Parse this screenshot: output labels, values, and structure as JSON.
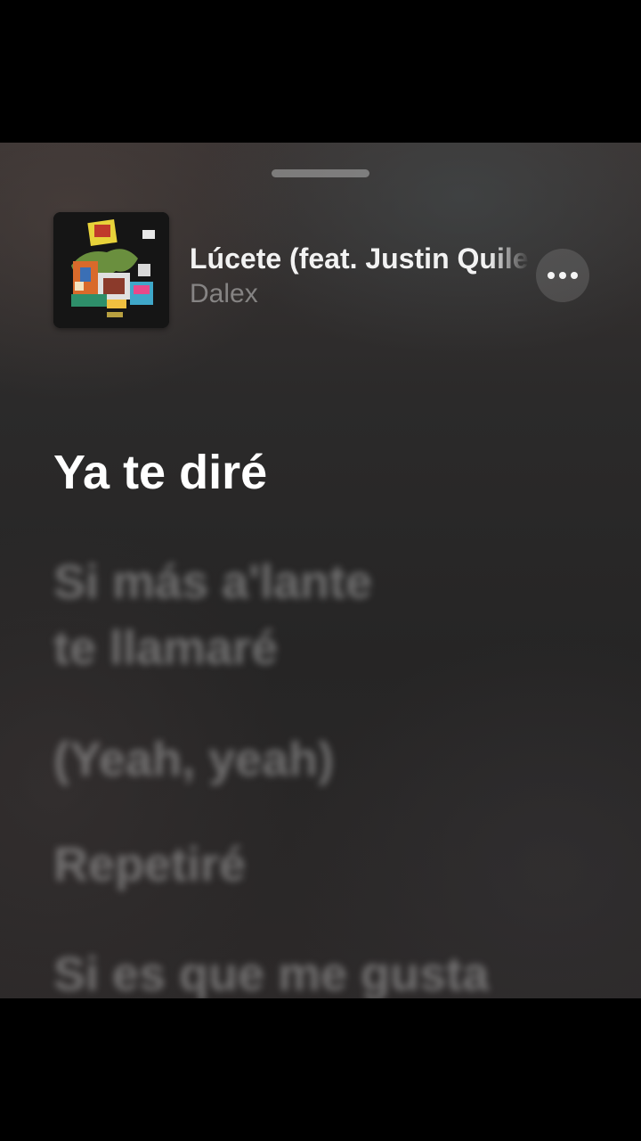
{
  "now_playing": {
    "title": "Lúcete (feat. Justin Quiles)",
    "artist": "Dalex"
  },
  "lyrics": {
    "active": "Ya te diré",
    "upcoming": [
      "Si más a'lante",
      "te llamaré",
      "(Yeah, yeah)",
      "Repetiré",
      "Si es que me gusta"
    ]
  },
  "colors": {
    "active_lyric": "#ffffff",
    "inactive_lyric": "#c8c8c8",
    "sheet_background": "#2b2a2a"
  },
  "icons": {
    "more": "ellipsis-icon"
  }
}
